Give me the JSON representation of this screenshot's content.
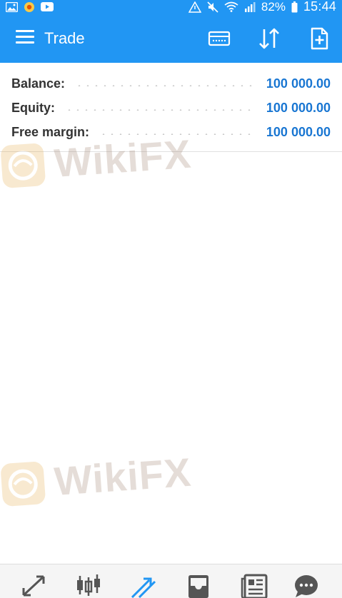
{
  "status_bar": {
    "battery_percent": "82%",
    "time": "15:44",
    "left_icons": [
      "gallery-icon",
      "launcher-icon",
      "youtube-icon"
    ],
    "right_icons": [
      "data-saver-icon",
      "mute-icon",
      "wifi-icon",
      "signal-icon",
      "battery-icon"
    ]
  },
  "toolbar": {
    "title": "Trade",
    "actions": [
      "account-card-icon",
      "sort-icon",
      "new-order-icon"
    ]
  },
  "account": {
    "balance_label": "Balance:",
    "balance_value": "100 000.00",
    "equity_label": "Equity:",
    "equity_value": "100 000.00",
    "free_margin_label": "Free margin:",
    "free_margin_value": "100 000.00"
  },
  "watermark": {
    "text": "WikiFX"
  },
  "bottom_nav": {
    "items": [
      "quotes-icon",
      "charts-icon",
      "trade-icon",
      "history-icon",
      "news-icon",
      "messages-icon"
    ],
    "active": "trade-icon",
    "active_color": "#2196f3",
    "inactive_color": "#555555"
  },
  "colors": {
    "primary": "#2196f3",
    "value_text": "#1976d2"
  }
}
